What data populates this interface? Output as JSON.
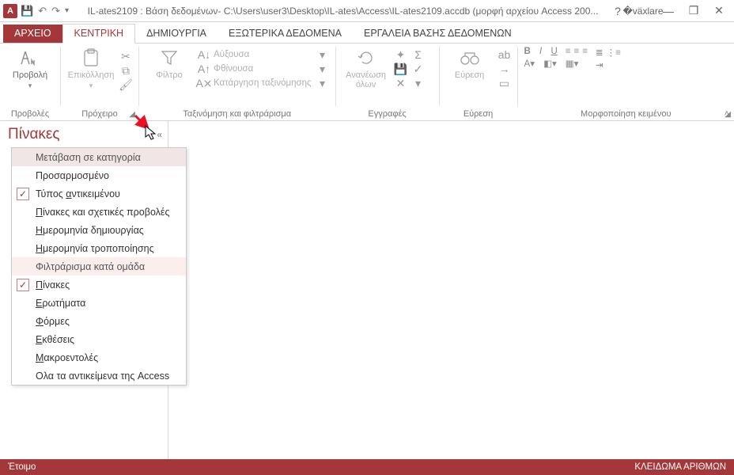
{
  "titlebar": {
    "app_letter": "A",
    "title": "IL-ates2109 : Βάση δεδομένων- C:\\Users\\user3\\Desktop\\IL-ates\\Access\\IL-ates2109.accdb (μορφή αρχείου Access 200...",
    "help": "?",
    "min": "—",
    "max": "❐",
    "close": "✕"
  },
  "tabs": {
    "file": "ΑΡΧΕΙΟ",
    "home": "ΚΕΝΤΡΙΚΗ",
    "create": "ΔΗΜΙΟΥΡΓΙΑ",
    "external": "ΕΞΩΤΕΡΙΚΑ ΔΕΔΟΜΕΝΑ",
    "dbtools": "ΕΡΓΑΛΕΙΑ ΒΑΣΗΣ ΔΕΔΟΜΕΝΩΝ"
  },
  "ribbon": {
    "views": {
      "btn": "Προβολή",
      "label": "Προβολές"
    },
    "clipboard": {
      "paste": "Επικόλληση",
      "label": "Πρόχειρο"
    },
    "sortfilter": {
      "filter": "Φίλτρο",
      "asc": "Αύξουσα",
      "desc": "Φθίνουσα",
      "clear_sort": "Κατάργηση ταξινόμησης",
      "label": "Ταξινόμηση και φιλτράρισμα"
    },
    "records": {
      "refresh": "Ανανέωση\nόλων",
      "label": "Εγγραφές"
    },
    "find": {
      "find": "Εύρεση",
      "label": "Εύρεση"
    },
    "textfmt": {
      "label": "Μορφοποίηση κειμένου"
    }
  },
  "navpane": {
    "header": "Πίνακες"
  },
  "ctxmenu": {
    "header1": "Μετάβαση σε κατηγορία",
    "custom": "Προσαρμοσμένο",
    "obj_type_pre": "Τύπος ",
    "obj_type_u": "α",
    "obj_type_post": "ντικειμένου",
    "tables_views_u": "Π",
    "tables_views_post": "ίνακες και σχετικές προβολές",
    "created_u": "Η",
    "created_post": "μερομηνία δημιουργίας",
    "modified_u": "Η",
    "modified_post": "μερομηνία τροποποίησης",
    "header2": "Φιλτράρισμα κατά ομάδα",
    "tables_u": "Π",
    "tables_post": "ίνακες",
    "queries_u": "Ε",
    "queries_post": "ρωτήματα",
    "forms_u": "Φ",
    "forms_post": "όρμες",
    "reports_u": "Ε",
    "reports_post": "κθέσεις",
    "macros_u": "Μ",
    "macros_post": "ακροεντολές",
    "all_objects": "Ολα τα αντικείμενα της Access"
  },
  "statusbar": {
    "ready": "Έτοιμο",
    "numlock": "ΚΛΕΙΔΩΜΑ ΑΡΙΘΜΩΝ"
  }
}
